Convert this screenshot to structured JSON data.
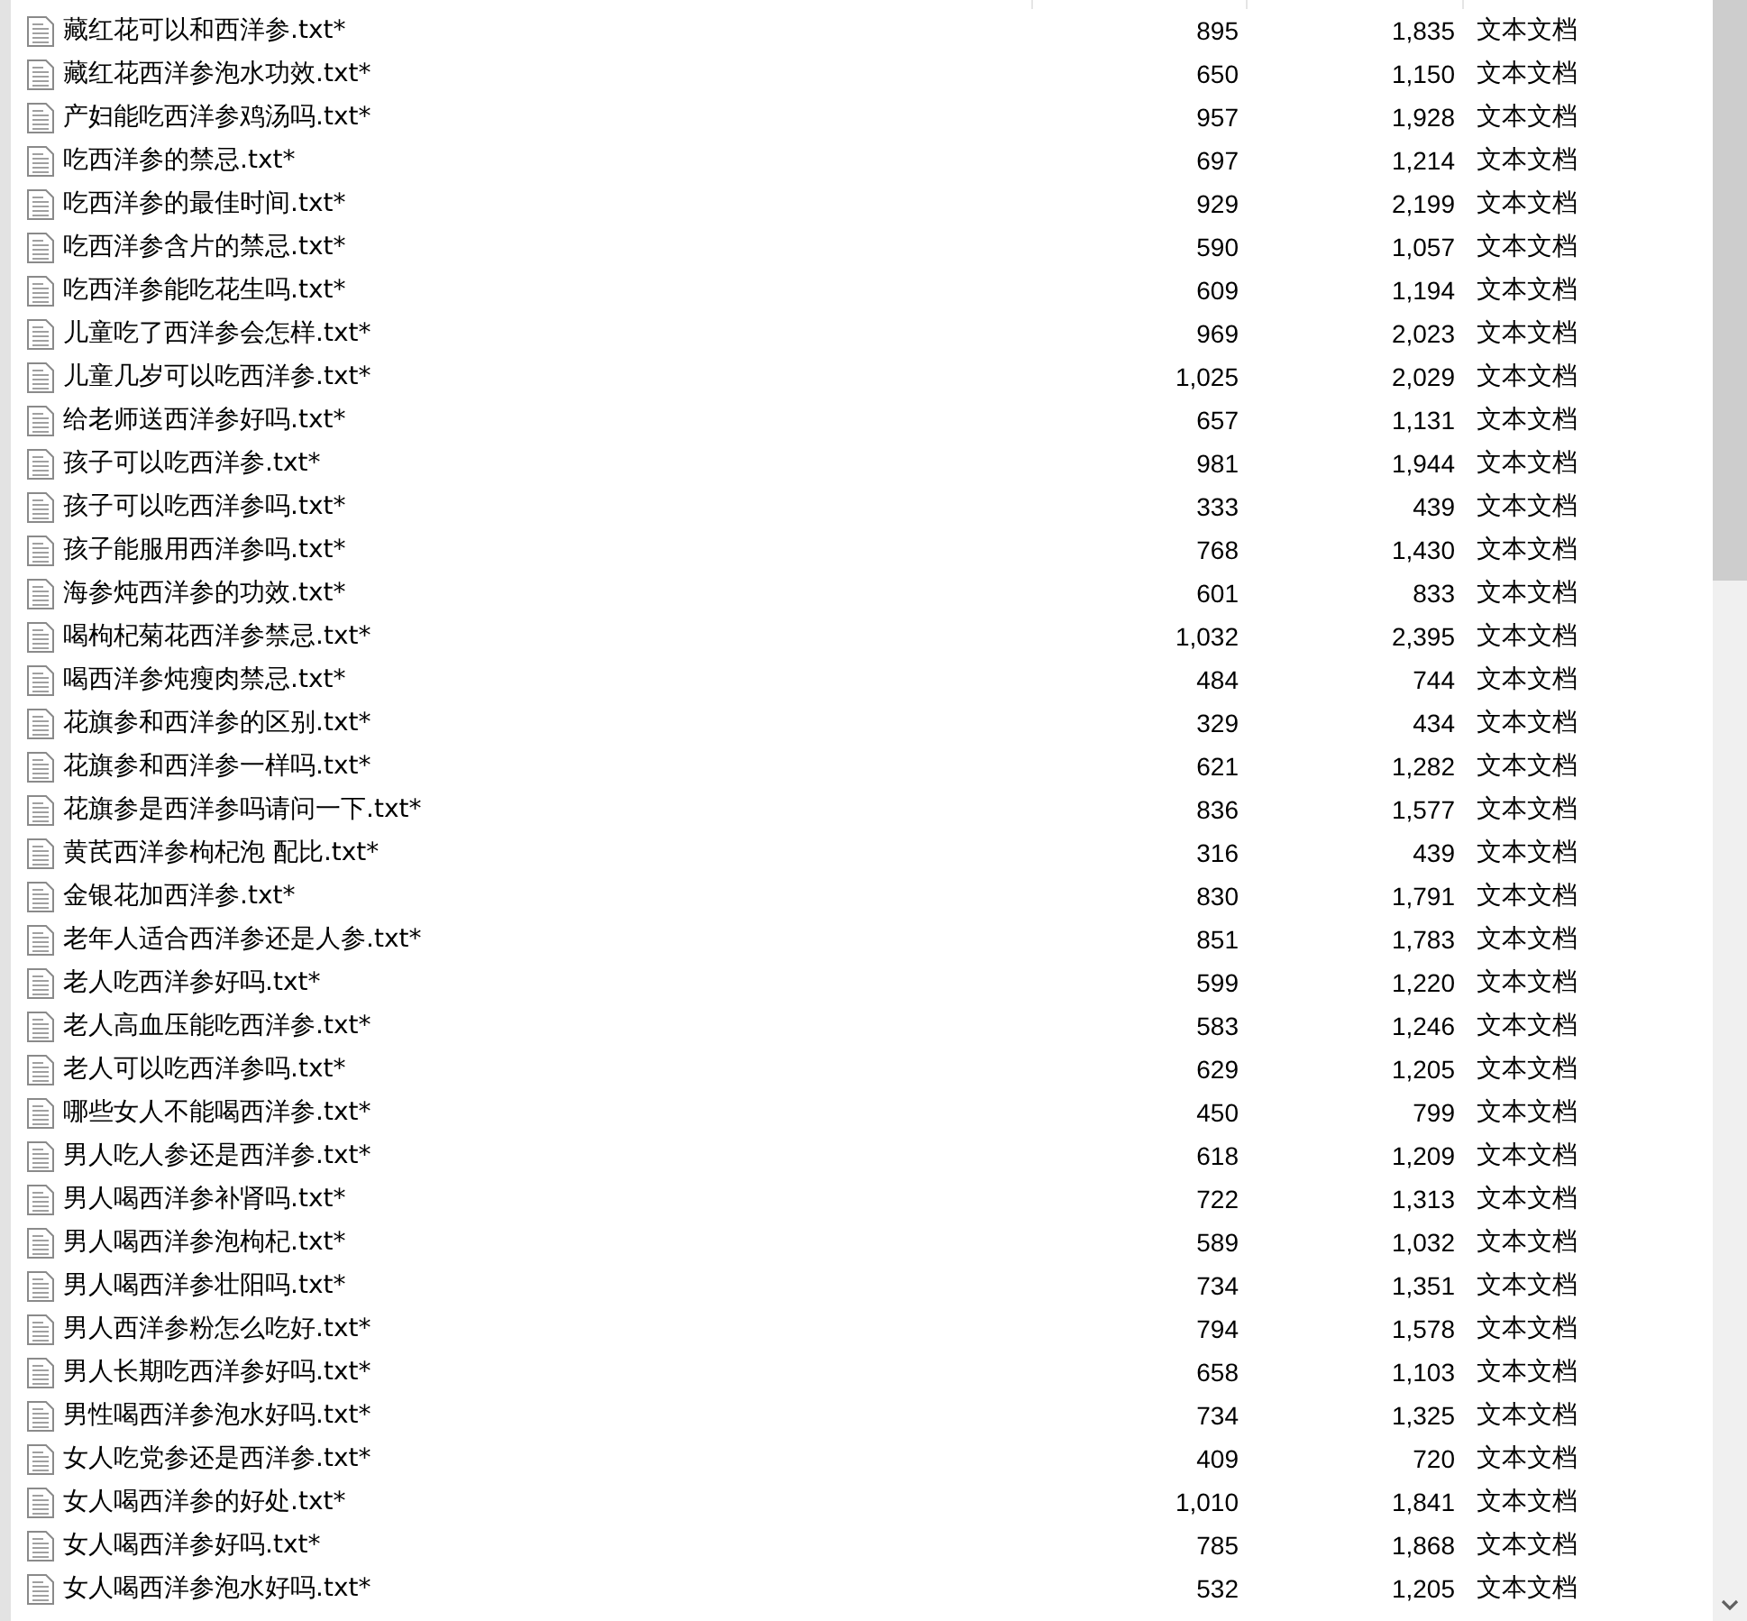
{
  "rows": [
    {
      "name": "藏红花可以和西洋参.txt*",
      "column_2": "895",
      "column_3": "1,835",
      "column_4": "文本文档"
    },
    {
      "name": "藏红花西洋参泡水功效.txt*",
      "column_2": "650",
      "column_3": "1,150",
      "column_4": "文本文档"
    },
    {
      "name": "产妇能吃西洋参鸡汤吗.txt*",
      "column_2": "957",
      "column_3": "1,928",
      "column_4": "文本文档"
    },
    {
      "name": "吃西洋参的禁忌.txt*",
      "column_2": "697",
      "column_3": "1,214",
      "column_4": "文本文档"
    },
    {
      "name": "吃西洋参的最佳时间.txt*",
      "column_2": "929",
      "column_3": "2,199",
      "column_4": "文本文档"
    },
    {
      "name": "吃西洋参含片的禁忌.txt*",
      "column_2": "590",
      "column_3": "1,057",
      "column_4": "文本文档"
    },
    {
      "name": "吃西洋参能吃花生吗.txt*",
      "column_2": "609",
      "column_3": "1,194",
      "column_4": "文本文档"
    },
    {
      "name": "儿童吃了西洋参会怎样.txt*",
      "column_2": "969",
      "column_3": "2,023",
      "column_4": "文本文档"
    },
    {
      "name": "儿童几岁可以吃西洋参.txt*",
      "column_2": "1,025",
      "column_3": "2,029",
      "column_4": "文本文档"
    },
    {
      "name": "给老师送西洋参好吗.txt*",
      "column_2": "657",
      "column_3": "1,131",
      "column_4": "文本文档"
    },
    {
      "name": "孩子可以吃西洋参.txt*",
      "column_2": "981",
      "column_3": "1,944",
      "column_4": "文本文档"
    },
    {
      "name": "孩子可以吃西洋参吗.txt*",
      "column_2": "333",
      "column_3": "439",
      "column_4": "文本文档"
    },
    {
      "name": "孩子能服用西洋参吗.txt*",
      "column_2": "768",
      "column_3": "1,430",
      "column_4": "文本文档"
    },
    {
      "name": "海参炖西洋参的功效.txt*",
      "column_2": "601",
      "column_3": "833",
      "column_4": "文本文档"
    },
    {
      "name": "喝枸杞菊花西洋参禁忌.txt*",
      "column_2": "1,032",
      "column_3": "2,395",
      "column_4": "文本文档"
    },
    {
      "name": "喝西洋参炖瘦肉禁忌.txt*",
      "column_2": "484",
      "column_3": "744",
      "column_4": "文本文档"
    },
    {
      "name": "花旗参和西洋参的区别.txt*",
      "column_2": "329",
      "column_3": "434",
      "column_4": "文本文档"
    },
    {
      "name": "花旗参和西洋参一样吗.txt*",
      "column_2": "621",
      "column_3": "1,282",
      "column_4": "文本文档"
    },
    {
      "name": "花旗参是西洋参吗请问一下.txt*",
      "column_2": "836",
      "column_3": "1,577",
      "column_4": "文本文档"
    },
    {
      "name": "黄芪西洋参枸杞泡 配比.txt*",
      "column_2": "316",
      "column_3": "439",
      "column_4": "文本文档"
    },
    {
      "name": "金银花加西洋参.txt*",
      "column_2": "830",
      "column_3": "1,791",
      "column_4": "文本文档"
    },
    {
      "name": "老年人适合西洋参还是人参.txt*",
      "column_2": "851",
      "column_3": "1,783",
      "column_4": "文本文档"
    },
    {
      "name": "老人吃西洋参好吗.txt*",
      "column_2": "599",
      "column_3": "1,220",
      "column_4": "文本文档"
    },
    {
      "name": "老人高血压能吃西洋参.txt*",
      "column_2": "583",
      "column_3": "1,246",
      "column_4": "文本文档"
    },
    {
      "name": "老人可以吃西洋参吗.txt*",
      "column_2": "629",
      "column_3": "1,205",
      "column_4": "文本文档"
    },
    {
      "name": "哪些女人不能喝西洋参.txt*",
      "column_2": "450",
      "column_3": "799",
      "column_4": "文本文档"
    },
    {
      "name": "男人吃人参还是西洋参.txt*",
      "column_2": "618",
      "column_3": "1,209",
      "column_4": "文本文档"
    },
    {
      "name": "男人喝西洋参补肾吗.txt*",
      "column_2": "722",
      "column_3": "1,313",
      "column_4": "文本文档"
    },
    {
      "name": "男人喝西洋参泡枸杞.txt*",
      "column_2": "589",
      "column_3": "1,032",
      "column_4": "文本文档"
    },
    {
      "name": "男人喝西洋参壮阳吗.txt*",
      "column_2": "734",
      "column_3": "1,351",
      "column_4": "文本文档"
    },
    {
      "name": "男人西洋参粉怎么吃好.txt*",
      "column_2": "794",
      "column_3": "1,578",
      "column_4": "文本文档"
    },
    {
      "name": "男人长期吃西洋参好吗.txt*",
      "column_2": "658",
      "column_3": "1,103",
      "column_4": "文本文档"
    },
    {
      "name": "男性喝西洋参泡水好吗.txt*",
      "column_2": "734",
      "column_3": "1,325",
      "column_4": "文本文档"
    },
    {
      "name": "女人吃党参还是西洋参.txt*",
      "column_2": "409",
      "column_3": "720",
      "column_4": "文本文档"
    },
    {
      "name": "女人喝西洋参的好处.txt*",
      "column_2": "1,010",
      "column_3": "1,841",
      "column_4": "文本文档"
    },
    {
      "name": "女人喝西洋参好吗.txt*",
      "column_2": "785",
      "column_3": "1,868",
      "column_4": "文本文档"
    },
    {
      "name": "女人喝西洋参泡水好吗.txt*",
      "column_2": "532",
      "column_3": "1,205",
      "column_4": "文本文档"
    }
  ]
}
